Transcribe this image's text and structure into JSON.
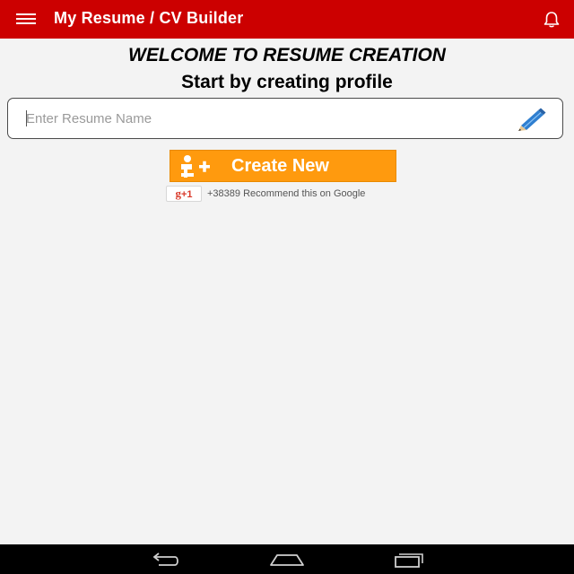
{
  "app_bar": {
    "title": "My Resume / CV Builder",
    "menu_icon": "hamburger-menu-icon",
    "notification_icon": "bell-icon",
    "background_color": "#cc0000"
  },
  "main": {
    "welcome_heading": "WELCOME TO RESUME CREATION",
    "subtitle": "Start by creating profile",
    "resume_name_input": {
      "placeholder": "Enter Resume Name",
      "value": "",
      "edit_icon": "pencil-icon"
    },
    "create_button": {
      "label": "Create New",
      "icon": "add-person-icon",
      "color": "#ff9a0e"
    },
    "google_plus": {
      "button_g": "g",
      "button_plus": "+1",
      "recommend_text": "+38389 Recommend this on Google"
    }
  },
  "system_nav": {
    "back_icon": "back-icon",
    "home_icon": "home-icon",
    "recents_icon": "recent-apps-icon"
  }
}
